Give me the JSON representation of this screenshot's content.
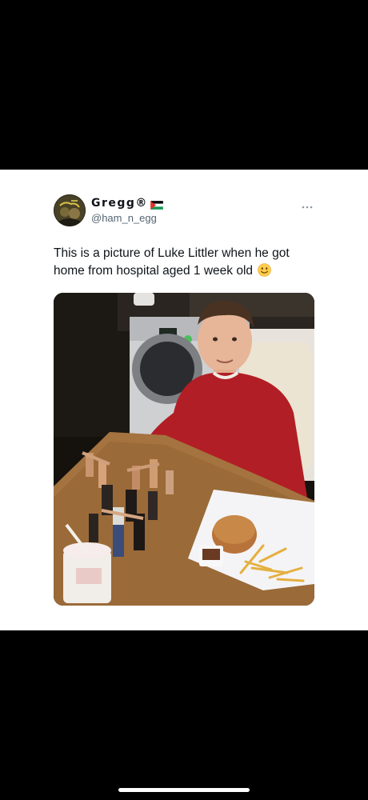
{
  "tweet": {
    "display_name": "Gregg®",
    "handle": "@ham_n_egg",
    "text": "This is a picture of Luke Littler when he got home from hospital aged 1 week old",
    "name_icon": "palestine-flag-icon",
    "text_icon": "slightly-smiling-face-icon",
    "menu_icon": "more-dots-icon"
  },
  "colors": {
    "background": "#000000",
    "card": "#ffffff",
    "text_primary": "#0f1419",
    "text_secondary": "#536471",
    "sweater": "#b21e25",
    "table": "#9a6a38"
  }
}
